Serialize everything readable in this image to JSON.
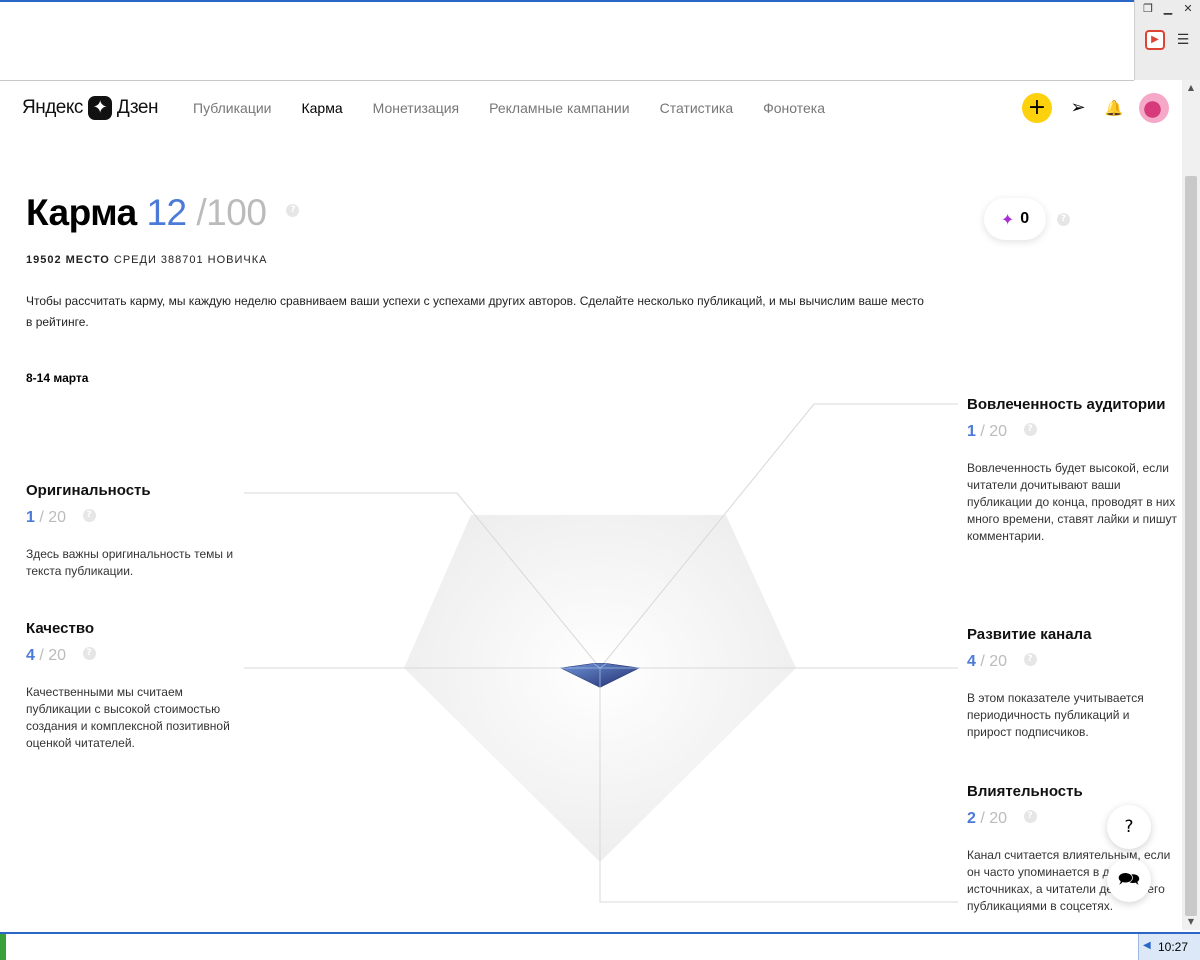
{
  "header": {
    "logo_left": "Яндекс",
    "logo_right": "Дзен",
    "nav": [
      {
        "label": "Публикации",
        "active": false
      },
      {
        "label": "Карма",
        "active": true
      },
      {
        "label": "Монетизация",
        "active": false
      },
      {
        "label": "Рекламные кампании",
        "active": false
      },
      {
        "label": "Статистика",
        "active": false
      },
      {
        "label": "Фонотека",
        "active": false
      }
    ],
    "plus_glyph": "+",
    "send_glyph": "➢",
    "bell_glyph": "🔔"
  },
  "karma": {
    "title": "Карма",
    "score": "12",
    "max": "/100",
    "help": "?",
    "rank_place": "19502 МЕСТО",
    "rank_rest": "СРЕДИ 388701 НОВИЧКА",
    "description": "Чтобы рассчитать карму, мы каждую неделю сравниваем ваши успехи с успехами других авторов. Сделайте несколько публикаций, и мы вычислим ваше место в рейтинге.",
    "period": "8-14 марта",
    "gems": "0"
  },
  "metrics": {
    "originality": {
      "title": "Оригинальность",
      "score": "1",
      "max": "/ 20",
      "desc": "Здесь важны оригинальность темы и текста публикации."
    },
    "quality": {
      "title": "Качество",
      "score": "4",
      "max": "/ 20",
      "desc": "Качественными мы считаем публикации с высокой стоимостью создания и комплексной позитивной оценкой читателей."
    },
    "engagement": {
      "title": "Вовлеченность аудитории",
      "score": "1",
      "max": "/ 20",
      "desc": "Вовлеченность будет высокой, если читатели дочитывают ваши публикации до конца, проводят в них много времени, ставят лайки и пишут комментарии."
    },
    "growth": {
      "title": "Развитие канала",
      "score": "4",
      "max": "/ 20",
      "desc": "В этом показателе учитывается периодичность публикаций и прирост подписчиков."
    },
    "influence": {
      "title": "Влиятельность",
      "score": "2",
      "max": "/ 20",
      "desc": "Канал считается влиятельным, если он часто упоминается в других источниках, а читатели делятся его публикациями в соцсетях."
    }
  },
  "chart_data": {
    "type": "radar",
    "axes": [
      "Оригинальность",
      "Вовлеченность аудитории",
      "Развитие канала",
      "Влиятельность",
      "Качество"
    ],
    "values": [
      1,
      1,
      4,
      2,
      4
    ],
    "max": 20
  },
  "help_fab": "?",
  "taskbar": {
    "clock": "10:27"
  },
  "colors": {
    "accent": "#4b7ad8",
    "yellow": "#fdd10c",
    "gem": "#a82ed6",
    "gem_dark": "#1e2a6b"
  }
}
